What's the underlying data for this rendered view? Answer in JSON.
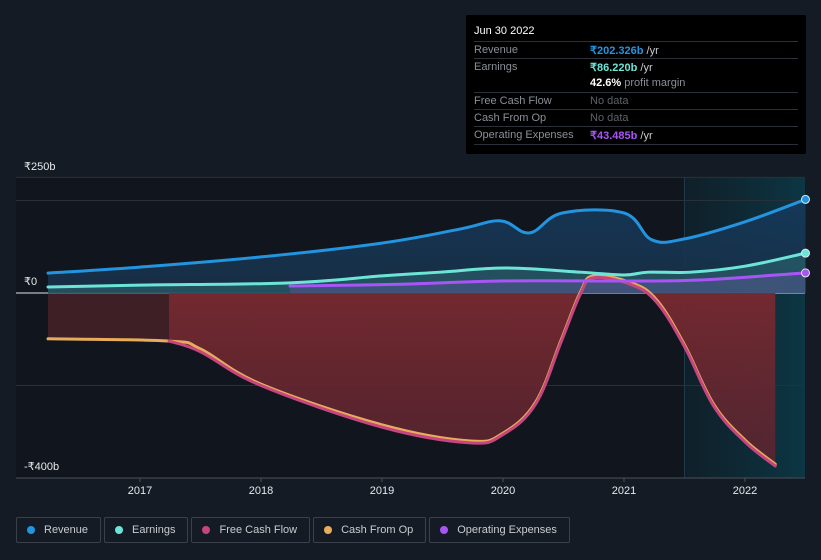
{
  "tooltip": {
    "date": "Jun 30 2022",
    "rows": [
      {
        "label": "Revenue",
        "value": "₹202.326b",
        "unit": " /yr",
        "color": "#2394df"
      },
      {
        "label": "Earnings",
        "value": "₹86.220b",
        "unit": " /yr",
        "color": "#6ce5d6"
      },
      {
        "label": "",
        "value": "42.6%",
        "unit": " profit margin",
        "color": "#ffffff"
      },
      {
        "label": "Free Cash Flow",
        "value": "No data",
        "unit": "",
        "color": "#5d626b"
      },
      {
        "label": "Cash From Op",
        "value": "No data",
        "unit": "",
        "color": "#5d626b"
      },
      {
        "label": "Operating Expenses",
        "value": "₹43.485b",
        "unit": " /yr",
        "color": "#a855f7"
      }
    ]
  },
  "chart_data": {
    "type": "area",
    "title": "",
    "xlabel": "",
    "ylabel": "",
    "ylim": [
      -400,
      250
    ],
    "xlim": [
      2016.0,
      2022.55
    ],
    "y_tick_labels": [
      {
        "value": 250,
        "label": "₹250b"
      },
      {
        "value": 0,
        "label": "₹0"
      },
      {
        "value": -400,
        "label": "-₹400b"
      }
    ],
    "gridlines": [
      250,
      200,
      0,
      -200,
      -400
    ],
    "x_ticks": [
      2017,
      2018,
      2019,
      2020,
      2021,
      2022
    ],
    "highlight_range": [
      2021.5,
      2022.5
    ],
    "legend_position": "bottom-left",
    "series": [
      {
        "name": "Revenue",
        "color": "#2394df",
        "x": [
          2016.24,
          2017.0,
          2018.0,
          2019.0,
          2019.64,
          2019.98,
          2020.22,
          2020.49,
          2021.0,
          2021.23,
          2021.5,
          2022.0,
          2022.5
        ],
        "values": [
          43,
          56,
          78,
          108,
          138,
          156,
          130,
          173,
          173,
          115,
          117,
          154,
          202.3
        ]
      },
      {
        "name": "Earnings",
        "color": "#6ce5d6",
        "x": [
          2016.24,
          2017.0,
          2018.24,
          2019.0,
          2019.48,
          2020.02,
          2020.64,
          2021.0,
          2021.2,
          2021.55,
          2022.0,
          2022.5
        ],
        "values": [
          13,
          17,
          22,
          37,
          45,
          54,
          45,
          39,
          45,
          45,
          58,
          86.2
        ]
      },
      {
        "name": "Free Cash Flow",
        "color": "#c6457e",
        "x": [
          2017.24,
          2017.5,
          2018.0,
          2019.0,
          2019.73,
          2020.0,
          2020.27,
          2020.48,
          2020.64,
          2020.75,
          2021.06,
          2021.27,
          2021.5,
          2021.74,
          2022.0,
          2022.25
        ],
        "values": [
          -104,
          -127,
          -200,
          -290,
          -324,
          -306,
          -240,
          -106,
          -2,
          33,
          18,
          -20,
          -116,
          -244,
          -322,
          -374
        ]
      },
      {
        "name": "Cash From Op",
        "color": "#e8ad5c",
        "x": [
          2016.24,
          2017.24,
          2017.5,
          2018.0,
          2019.0,
          2019.73,
          2020.0,
          2020.27,
          2020.48,
          2020.64,
          2020.75,
          2021.06,
          2021.27,
          2021.5,
          2021.74,
          2022.0,
          2022.25
        ],
        "values": [
          -99,
          -104,
          -121,
          -197,
          -285,
          -320,
          -303,
          -236,
          -102,
          2,
          37,
          22,
          -15,
          -112,
          -240,
          -318,
          -370
        ]
      },
      {
        "name": "Operating Expenses",
        "color": "#a855f7",
        "x": [
          2018.24,
          2019.15,
          2019.98,
          2021.0,
          2021.62,
          2022.5
        ],
        "values": [
          15,
          19,
          26,
          26,
          28,
          43.5
        ]
      }
    ]
  },
  "legend": [
    {
      "label": "Revenue",
      "color": "#2394df"
    },
    {
      "label": "Earnings",
      "color": "#6ce5d6"
    },
    {
      "label": "Free Cash Flow",
      "color": "#c6457e"
    },
    {
      "label": "Cash From Op",
      "color": "#e8ad5c"
    },
    {
      "label": "Operating Expenses",
      "color": "#a855f7"
    }
  ]
}
